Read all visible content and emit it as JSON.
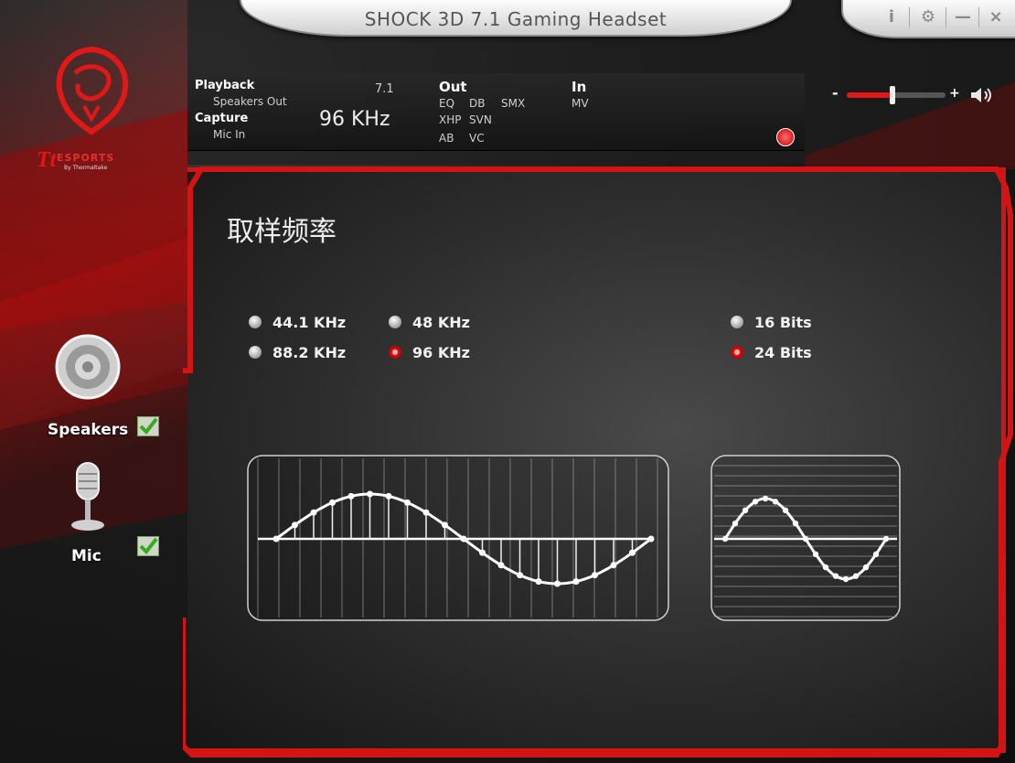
{
  "window": {
    "title": "SHOCK 3D 7.1 Gaming Headset",
    "controls": [
      {
        "name": "info",
        "glyph": "i"
      },
      {
        "name": "settings",
        "glyph": "⚙"
      },
      {
        "name": "minimize",
        "glyph": "—"
      },
      {
        "name": "close",
        "glyph": "×"
      }
    ]
  },
  "logo": {
    "brand": "ESPORTS",
    "sub": "By Thermaltake"
  },
  "info_bar": {
    "playback_label": "Playback",
    "speakers_out": "Speakers Out",
    "channels": "7.1",
    "capture_label": "Capture",
    "mic_in": "Mic In",
    "sample_rate": "96 KHz",
    "out_label": "Out",
    "out_effects": [
      "EQ",
      "DB",
      "SMX",
      "XHP",
      "SVN",
      "AB",
      "VC"
    ],
    "in_label": "In",
    "in_effects": [
      "MV"
    ]
  },
  "volume": {
    "minus": "-",
    "plus": "+",
    "level": 0.5
  },
  "sidebar": {
    "items": [
      {
        "label": "Speakers",
        "checked": true
      },
      {
        "label": "Mic",
        "checked": true
      }
    ]
  },
  "panel": {
    "title": "取样频率",
    "sample_rates": [
      {
        "label": "44.1 KHz",
        "selected": false
      },
      {
        "label": "48 KHz",
        "selected": false
      },
      {
        "label": "88.2 KHz",
        "selected": false
      },
      {
        "label": "96 KHz",
        "selected": true
      }
    ],
    "bit_depths": [
      {
        "label": "16 Bits",
        "selected": false
      },
      {
        "label": "24 Bits",
        "selected": true
      }
    ]
  },
  "colors": {
    "accent": "#d41414",
    "text": "#f2f2f2"
  }
}
